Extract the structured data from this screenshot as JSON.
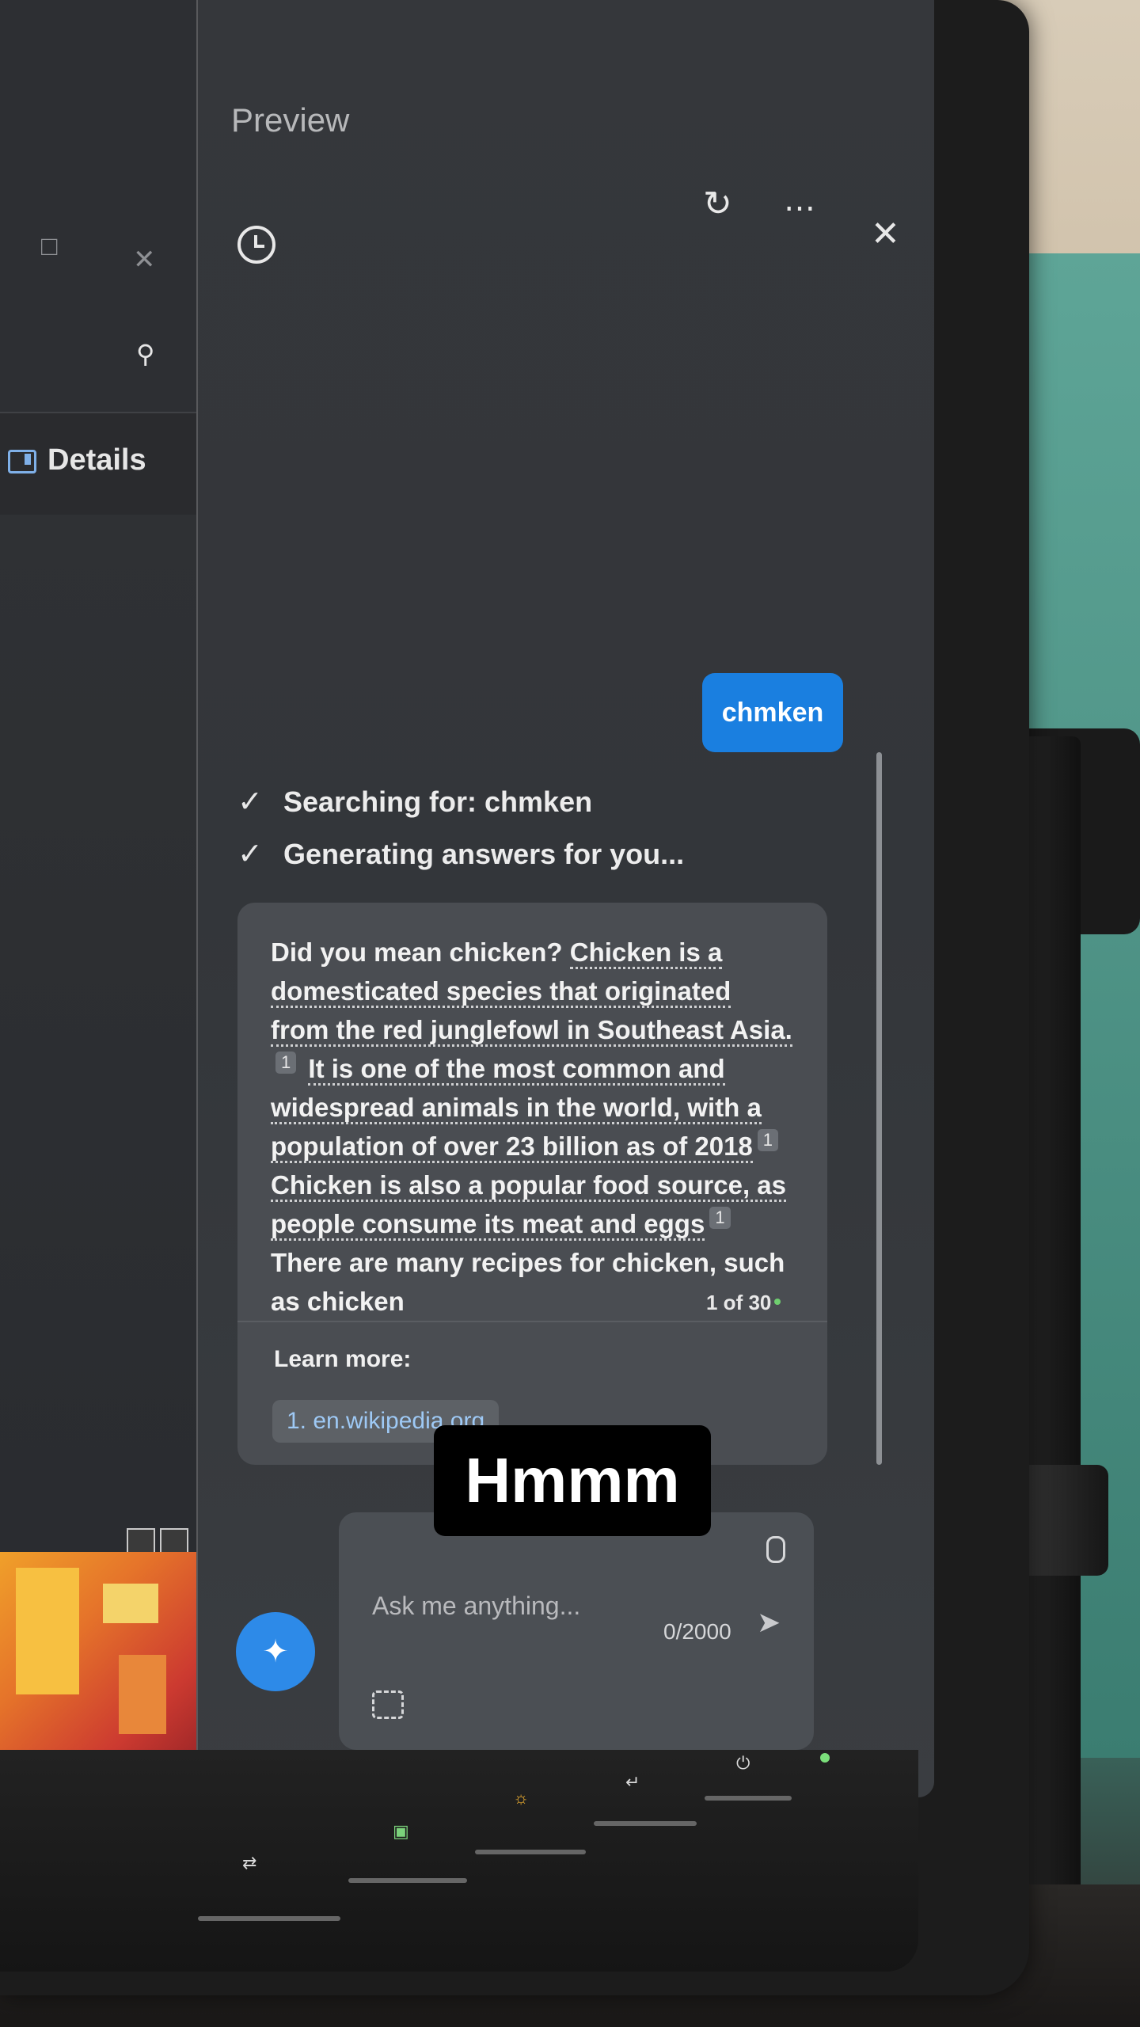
{
  "panel": {
    "title": "Preview"
  },
  "explorer": {
    "details_label": "Details"
  },
  "conversation": {
    "user_message": "chmken",
    "status_steps": [
      "Searching for: chmken",
      "Generating answers for you..."
    ],
    "answer": {
      "lead": "Did you mean chicken?",
      "s1": "Chicken is a domesticated species that originated from the red junglefowl in Southeast Asia.",
      "c1": "1",
      "s2": "It is one of the most common and widespread animals in the world, with a population of over 23 billion as of 2018",
      "c2": "1",
      "s3": "Chicken is also a popular food source, as people consume its meat and eggs",
      "c3": "1",
      "s4": "There are many recipes for chicken, such as chicken"
    },
    "page_indicator": "1 of 30",
    "learn_more_label": "Learn more:",
    "sources": [
      "1. en.wikipedia.org"
    ]
  },
  "composer": {
    "placeholder": "Ask me anything...",
    "char_count": "0/2000"
  },
  "overlay_text": "Hmmm",
  "colors": {
    "user_bubble": "#1a7fe0",
    "link": "#9ec9f5",
    "new_topic_button": "#2d8ae8"
  },
  "icons": [
    "history-icon",
    "refresh-icon",
    "more-icon",
    "close-icon",
    "search-icon",
    "mic-icon",
    "send-icon",
    "screenshot-icon",
    "new-topic-icon"
  ]
}
